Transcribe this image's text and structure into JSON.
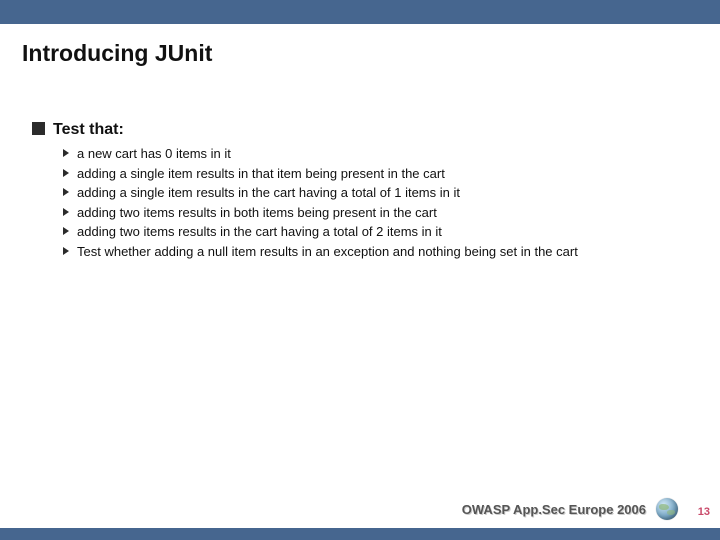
{
  "title": "Introducing JUnit",
  "heading": "Test that:",
  "bullets": [
    "a new cart has 0 items in it",
    "adding a single item results in that item being present in the cart",
    "adding a single item results in the cart having a total of 1 items in it",
    "adding two items results in both items being present in the cart",
    "adding two items results in the cart having a total of 2 items in it",
    "Test whether adding a null item results in an exception and nothing being set in the cart"
  ],
  "footer": "OWASP App.Sec Europe 2006",
  "page_number": "13"
}
